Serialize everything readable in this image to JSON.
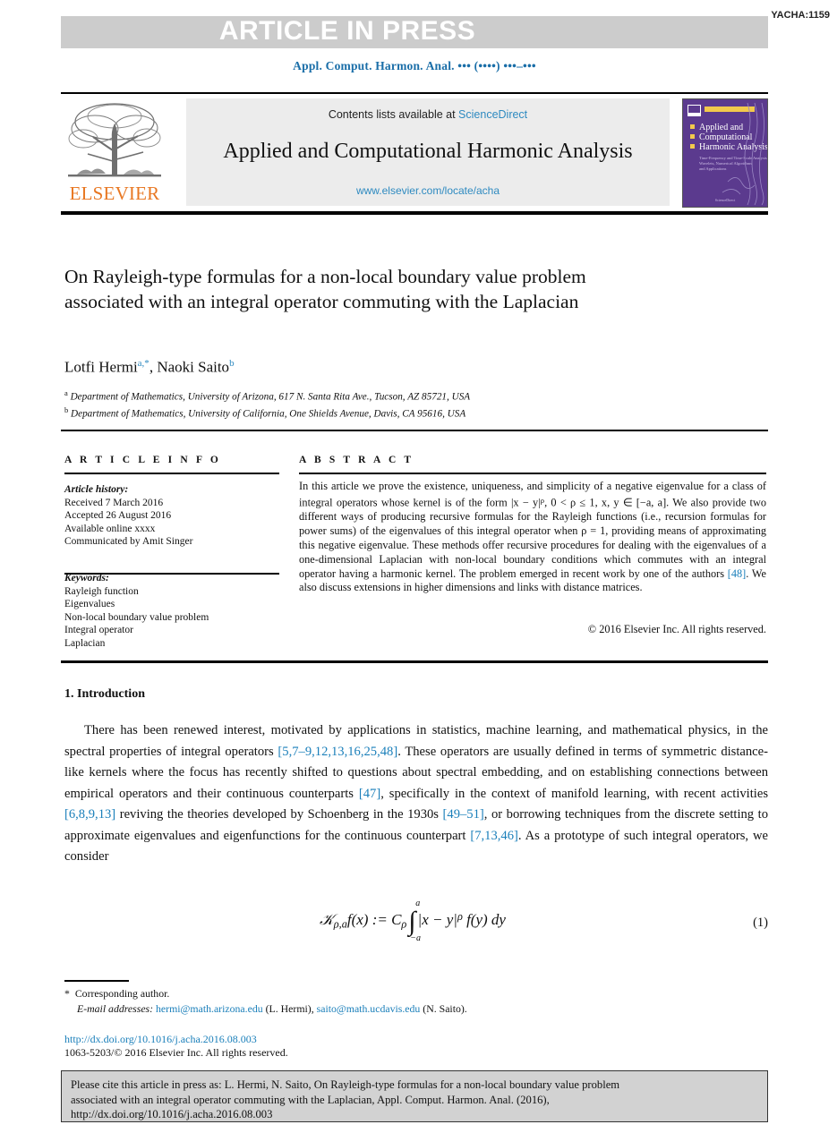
{
  "banner": {
    "label": "ARTICLE IN PRESS",
    "code": "YACHA:1159",
    "bg_color": "#cccccc"
  },
  "running_head": "Appl. Comput. Harmon. Anal. ••• (••••) •••–•••",
  "masthead": {
    "publisher": "ELSEVIER",
    "contents_prefix": "Contents lists available at ",
    "contents_link": "ScienceDirect",
    "journal_title": "Applied and Computational Harmonic Analysis",
    "journal_url": "www.elsevier.com/locate/acha",
    "cover_title_line1": "Applied and",
    "cover_title_line2": "Computational",
    "cover_title_line3": "Harmonic Analysis",
    "link_color": "#2e8ac0",
    "elsevier_orange": "#e87722",
    "cover_purple": "#5b3a8e"
  },
  "article": {
    "title": "On Rayleigh-type formulas for a non-local boundary value problem associated with an integral operator commuting with the Laplacian",
    "author1": "Lotfi Hermi",
    "author1_marks": "a,*",
    "author2": "Naoki Saito",
    "author2_marks": "b",
    "affiliation_a": "Department of Mathematics, University of Arizona, 617 N. Santa Rita Ave., Tucson, AZ 85721, USA",
    "affiliation_b": "Department of Mathematics, University of California, One Shields Avenue, Davis, CA 95616, USA"
  },
  "article_info": {
    "heading": "A R T I C L E   I N F O",
    "history_label": "Article history:",
    "received": "Received 7 March 2016",
    "accepted": "Accepted 26 August 2016",
    "available": "Available online xxxx",
    "communicated": "Communicated by Amit Singer",
    "keywords_label": "Keywords:",
    "keywords": [
      "Rayleigh function",
      "Eigenvalues",
      "Non-local boundary value problem",
      "Integral operator",
      "Laplacian"
    ]
  },
  "abstract": {
    "heading": "A B S T R A C T",
    "p1": "In this article we prove the existence, uniqueness, and simplicity of a negative eigenvalue for a class of integral operators whose kernel is of the form |x − y|",
    "p1_sup": "ρ",
    "p2": ", 0 < ρ ≤ 1, x, y ∈ [−a, a]. We also provide two different ways of producing recursive formulas for the Rayleigh functions (i.e., recursion formulas for power sums) of the eigenvalues of this integral operator when ρ = 1, providing means of approximating this negative eigenvalue. These methods offer recursive procedures for dealing with the eigenvalues of a one-dimensional Laplacian with non-local boundary conditions which commutes with an integral operator having a harmonic kernel. The problem emerged in recent work by one of the authors ",
    "ref_48": "[48]",
    "p3": ". We also discuss extensions in higher dimensions and links with distance matrices.",
    "copyright": "© 2016 Elsevier Inc. All rights reserved."
  },
  "body": {
    "section_number_title": "1. Introduction",
    "par_1a": "There has been renewed interest, motivated by applications in statistics, machine learning, and mathematical physics, in the spectral properties of integral operators ",
    "ref_1": "[5,7–9,12,13,16,25,48]",
    "par_1b": ". These operators are usually defined in terms of symmetric distance-like kernels where the focus has recently shifted to questions about spectral embedding, and on establishing connections between empirical operators and their continuous counterparts ",
    "ref_2": "[47]",
    "par_1c": ", specifically in the context of manifold learning, with recent activities ",
    "ref_3": "[6,8,9,13]",
    "par_1d": " reviving the theories developed by Schoenberg in the 1930s ",
    "ref_4": "[49–51]",
    "par_1e": ", or borrowing techniques from the discrete setting to approximate eigenvalues and eigenfunctions for the continuous counterpart ",
    "ref_5": "[7,13,46]",
    "par_1f": ". As a prototype of such integral operators, we consider"
  },
  "equation": {
    "operator": "𝒦",
    "operator_sub": "ρ,a",
    "lhs": "f(x) := C",
    "lhs_sub": "ρ",
    "integral_upper": "a",
    "integral_lower": "−a",
    "integrand": "|x − y|",
    "integrand_sup": "ρ",
    "integrand_tail": " f(y) dy",
    "number": "(1)"
  },
  "footnotes": {
    "star": "*",
    "corresponding": "Corresponding author.",
    "email_label": "E-mail addresses:",
    "email1": "hermi@math.arizona.edu",
    "email1_owner": "(L. Hermi),",
    "email2": "saito@math.ucdavis.edu",
    "email2_owner": "(N. Saito).",
    "doi": "http://dx.doi.org/10.1016/j.acha.2016.08.003",
    "issn": "1063-5203/© 2016 Elsevier Inc. All rights reserved."
  },
  "citation_box": {
    "line1": "Please cite this article in press as: L. Hermi, N. Saito, On Rayleigh-type formulas for a non-local boundary value problem",
    "line2": "associated with an integral operator commuting with the Laplacian, Appl. Comput. Harmon. Anal. (2016),",
    "line3": "http://dx.doi.org/10.1016/j.acha.2016.08.003"
  }
}
